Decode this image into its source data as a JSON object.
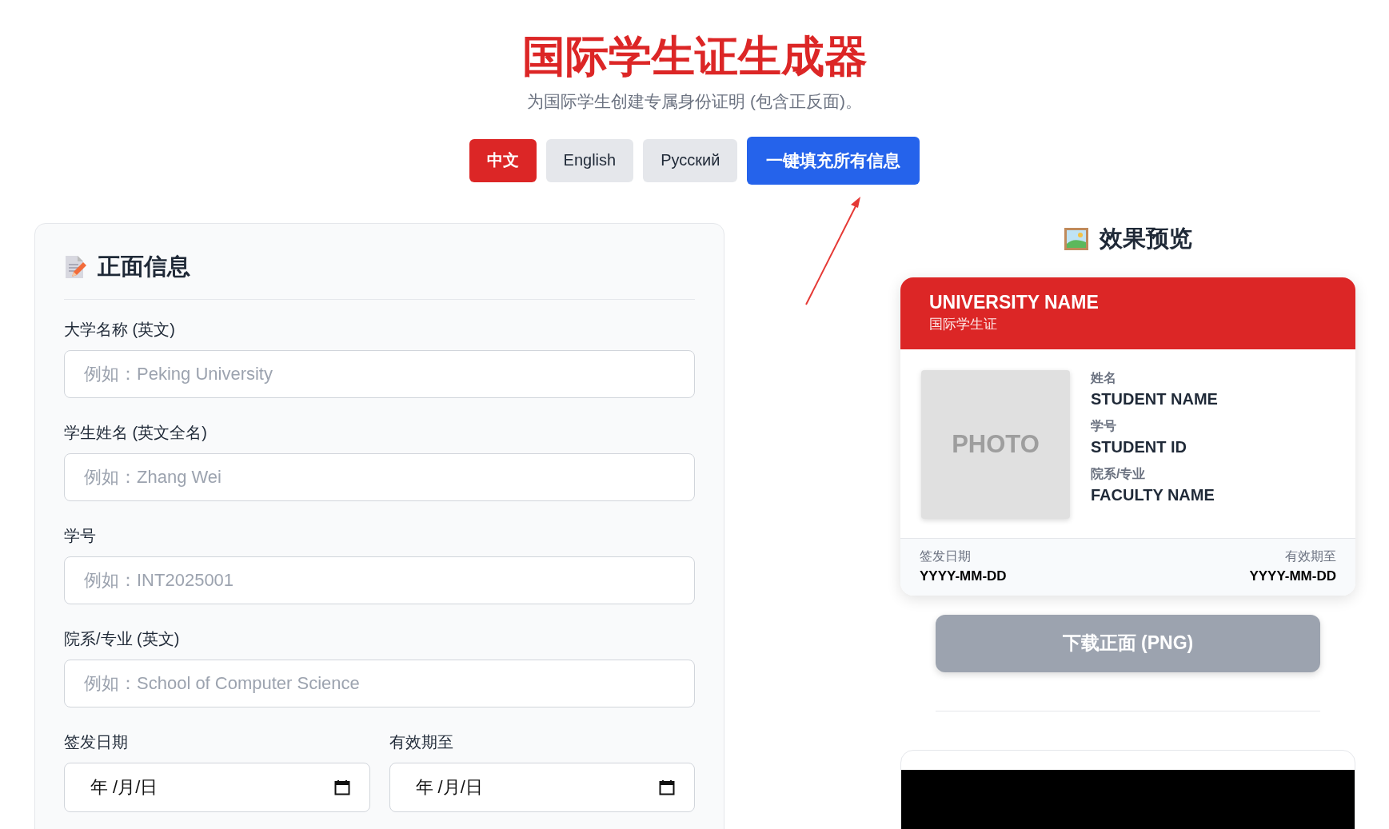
{
  "header": {
    "title": "国际学生证生成器",
    "subtitle": "为国际学生创建专属身份证明 (包含正反面)。"
  },
  "languages": [
    {
      "label": "中文",
      "selected": true
    },
    {
      "label": "English",
      "selected": false
    },
    {
      "label": "Русский",
      "selected": false
    }
  ],
  "fill_button": "一键填充所有信息",
  "form": {
    "title": "正面信息",
    "fields": [
      {
        "label": "大学名称 (英文)",
        "placeholder": "例如：Peking University"
      },
      {
        "label": "学生姓名 (英文全名)",
        "placeholder": "例如：Zhang Wei"
      },
      {
        "label": "学号",
        "placeholder": "例如：INT2025001"
      },
      {
        "label": "院系/专业 (英文)",
        "placeholder": "例如：School of Computer Science"
      }
    ],
    "date_fields": [
      {
        "label": "签发日期",
        "value": "年 /月/日"
      },
      {
        "label": "有效期至",
        "value": "年 /月/日"
      }
    ]
  },
  "preview": {
    "title": "效果预览",
    "card": {
      "university": "UNIVERSITY NAME",
      "subtitle": "国际学生证",
      "photo": "PHOTO",
      "info": [
        {
          "label": "姓名",
          "value": "STUDENT NAME"
        },
        {
          "label": "学号",
          "value": "STUDENT ID"
        },
        {
          "label": "院系/专业",
          "value": "FACULTY NAME"
        }
      ],
      "issue": {
        "label": "签发日期",
        "value": "YYYY-MM-DD"
      },
      "expiry": {
        "label": "有效期至",
        "value": "YYYY-MM-DD"
      }
    },
    "download_button": "下载正面 (PNG)"
  }
}
